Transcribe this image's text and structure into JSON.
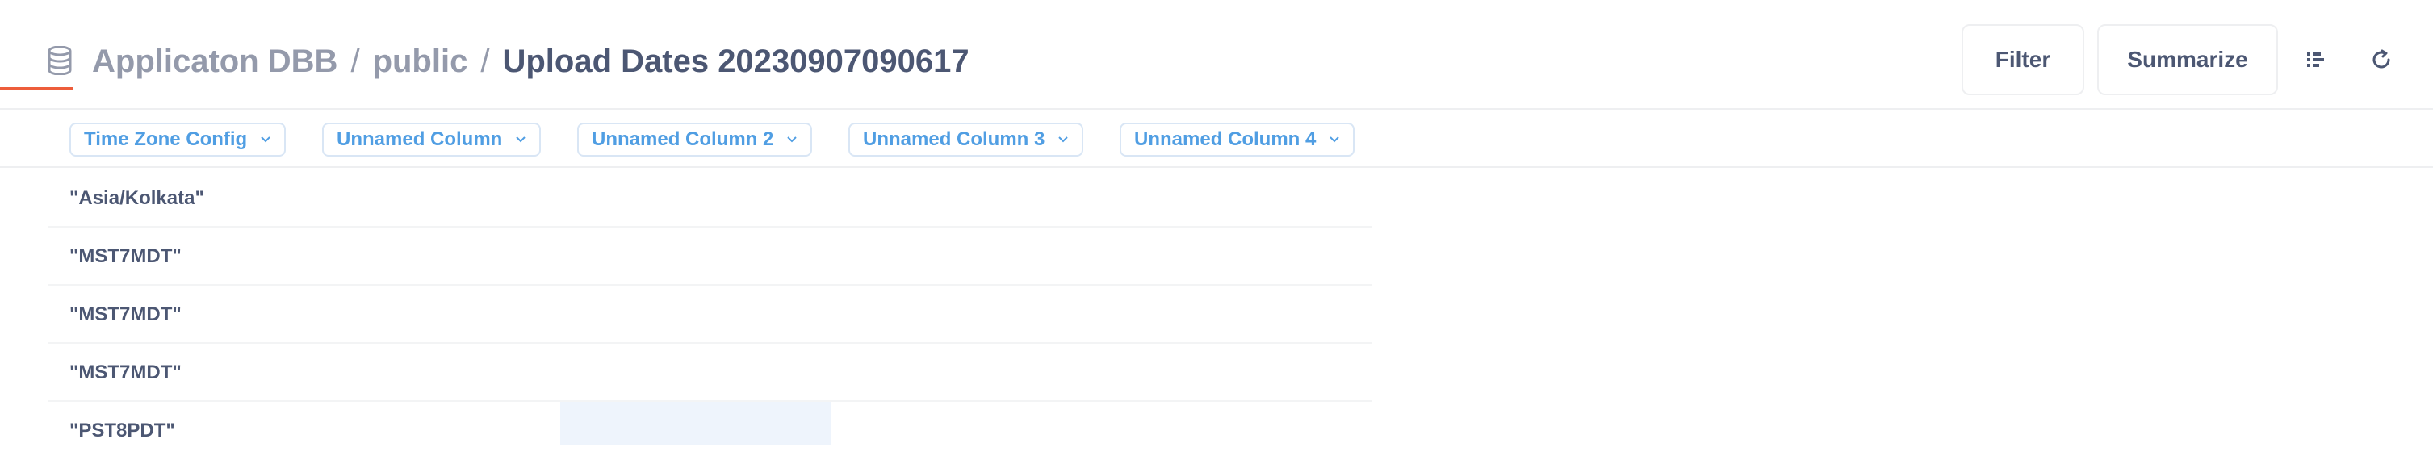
{
  "breadcrumb": {
    "database": "Applicaton DBB",
    "separator": "/",
    "schema": "public",
    "table": "Upload Dates 20230907090617"
  },
  "toolbar": {
    "filter_label": "Filter",
    "summarize_label": "Summarize",
    "list_icon": "list-icon",
    "refresh_icon": "refresh-icon"
  },
  "columns": [
    {
      "label": "Time Zone Config"
    },
    {
      "label": "Unnamed Column"
    },
    {
      "label": "Unnamed Column 2"
    },
    {
      "label": "Unnamed Column 3"
    },
    {
      "label": "Unnamed Column 4"
    }
  ],
  "rows": [
    {
      "time_zone": "\"Asia/Kolkata\""
    },
    {
      "time_zone": "\"MST7MDT\""
    },
    {
      "time_zone": "\"MST7MDT\""
    },
    {
      "time_zone": "\"MST7MDT\""
    },
    {
      "time_zone": "\"PST8PDT\""
    }
  ],
  "colors": {
    "accent": "#509ee3",
    "loading": "#ed5d3b",
    "text": "#4c5773",
    "muted": "#949aab"
  }
}
